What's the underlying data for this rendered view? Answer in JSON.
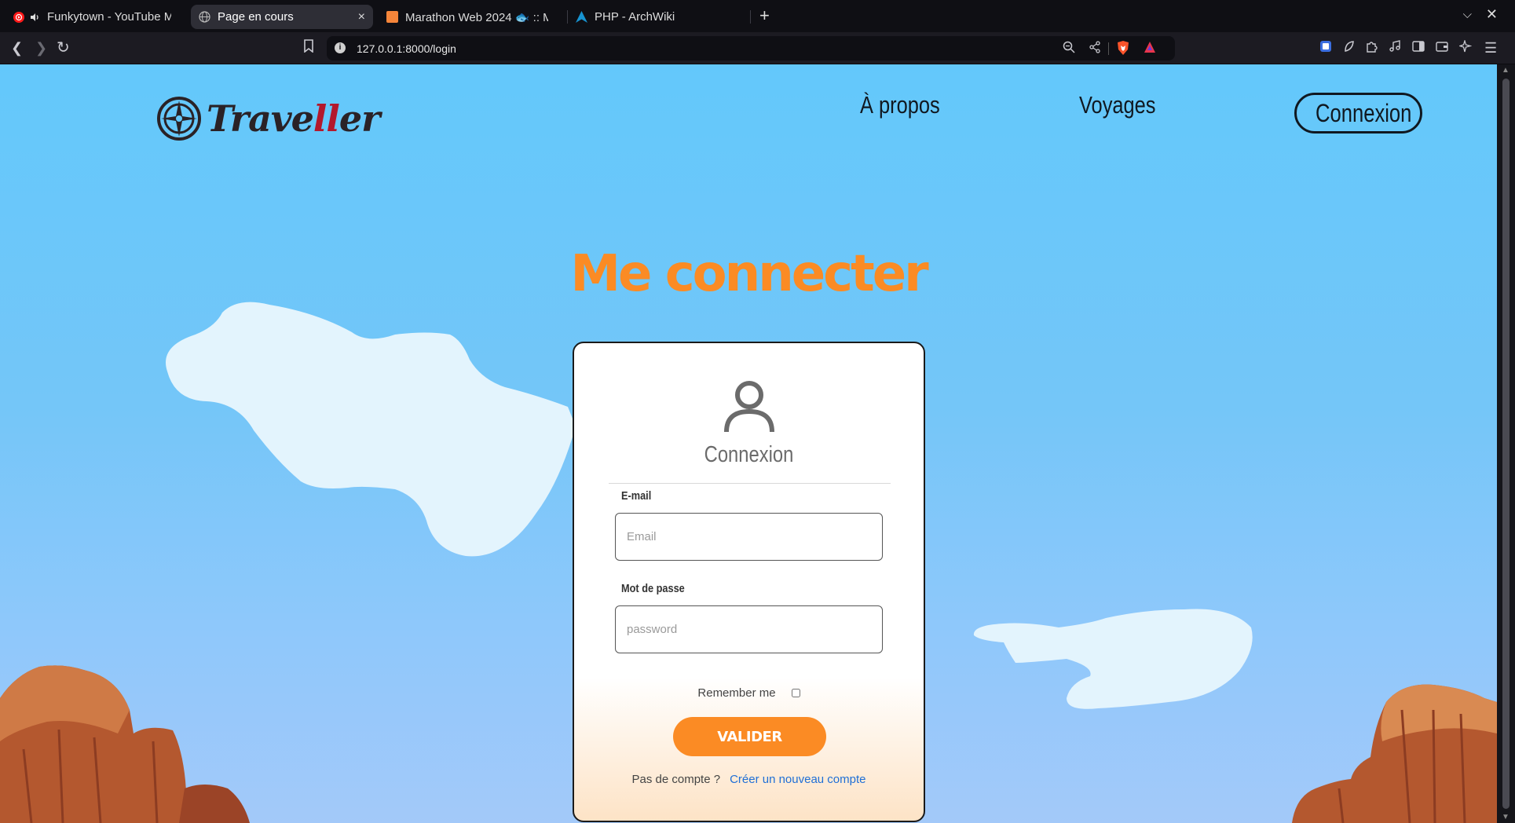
{
  "browser": {
    "tabs": [
      {
        "title": "Funkytown - YouTube Mu",
        "icon": "youtube-music-icon",
        "audio": true,
        "active": false
      },
      {
        "title": "Page en cours",
        "icon": "globe-icon",
        "active": true
      },
      {
        "title": "Marathon Web 2024 🐟 :: M",
        "icon": "orange-square-icon",
        "active": false
      },
      {
        "title": "PHP - ArchWiki",
        "icon": "arch-icon",
        "active": false
      }
    ],
    "new_tab": "+",
    "close_tab": "×",
    "url": "127.0.0.1:8000/login"
  },
  "header": {
    "logo_text_a": "Trave",
    "logo_text_b": "ll",
    "logo_text_c": "er",
    "nav": {
      "about": "À propos",
      "trips": "Voyages",
      "login": "Connexion"
    }
  },
  "page": {
    "title": "Me connecter"
  },
  "form": {
    "heading": "Connexion",
    "email_label": "E-mail",
    "email_placeholder": "Email",
    "password_label": "Mot de passe",
    "password_placeholder": "password",
    "remember_label": "Remember me",
    "submit_label": "VALIDER",
    "no_account": "Pas de compte ?",
    "create_account": "Créer un nouveau compte"
  },
  "colors": {
    "accent": "#fb8b24",
    "sky": "#63c8fb",
    "link": "#1f6fd6",
    "logo_red": "#b3182c"
  }
}
